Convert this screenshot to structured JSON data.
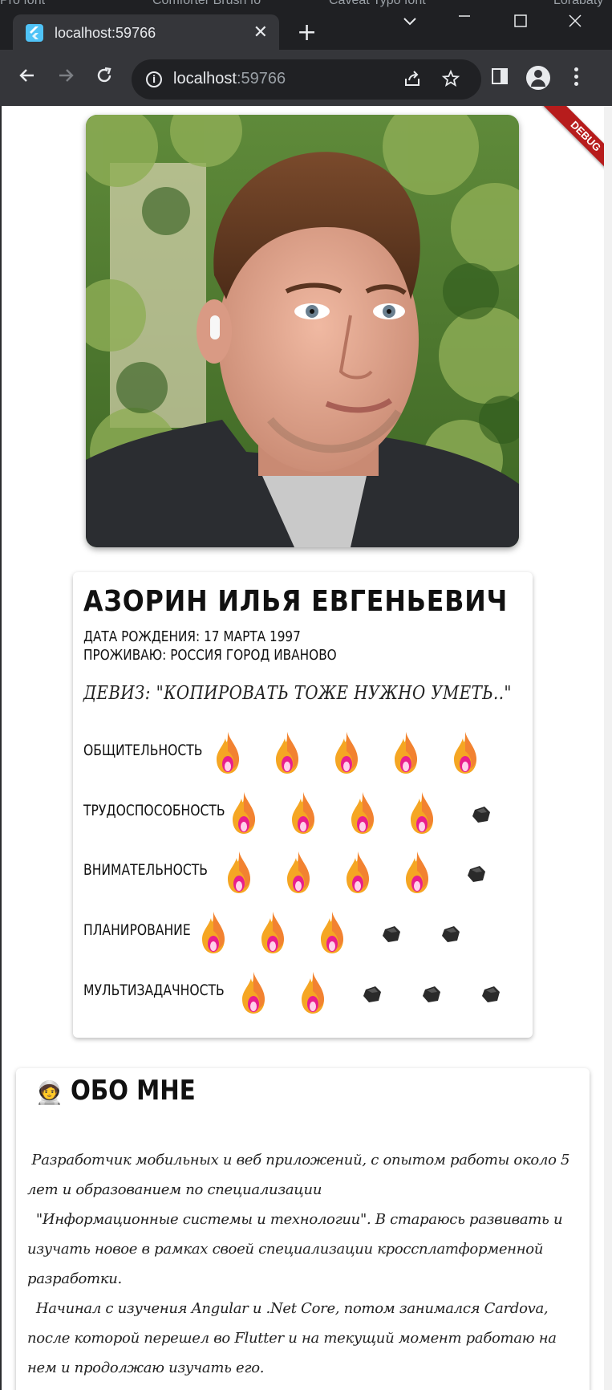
{
  "browser": {
    "tab_title": "localhost:59766",
    "tab_close": "✕",
    "new_tab": "+",
    "background_tabs": [
      "Pro font",
      "Comforter Brush fo",
      "Caveat Typo font",
      "Lorabaty"
    ],
    "url_host": "localhost",
    "url_port": ":59766",
    "icons": [
      "back-icon",
      "forward-icon",
      "reload-icon",
      "info-icon",
      "share-icon",
      "bookmark-star-icon",
      "side-panel-icon",
      "profile-icon",
      "menu-icon",
      "minimize-icon",
      "maximize-icon",
      "close-icon",
      "tab-search-icon"
    ]
  },
  "debug_banner": "DEBUG",
  "profile": {
    "name": "АЗОРИН ИЛЬЯ ЕВГЕНЬЕВИЧ",
    "birth": "ДАТА РОЖДЕНИЯ: 17 МАРТА 1997",
    "residence": "ПРОЖИВАЮ: РОССИЯ ГОРОД ИВАНОВО",
    "motto": "ДЕВИЗ: \"КОПИРОВАТЬ ТОЖЕ НУЖНО УМЕТЬ..\"",
    "skills": [
      {
        "label": "ОБЩИТЕЛЬНОСТЬ",
        "rating": 5,
        "max": 5
      },
      {
        "label": "ТРУДОСПОСОБНОСТЬ",
        "rating": 4,
        "max": 5
      },
      {
        "label": "ВНИМАТЕЛЬНОСТЬ",
        "rating": 4,
        "max": 5
      },
      {
        "label": "ПЛАНИРОВАНИЕ",
        "rating": 3,
        "max": 5
      },
      {
        "label": "МУЛЬТИЗАДАЧНОСТЬ",
        "rating": 2,
        "max": 5
      }
    ],
    "rating_icons": {
      "filled": "fire-icon",
      "empty": "coal-icon"
    }
  },
  "about": {
    "icon": "🧑‍🚀",
    "title": "ОБО МНЕ",
    "text": " Разработчик мобильных и веб приложений, с опытом работы около 5 лет и образованием по специализации\n  \"Информационные системы и технологии\". В стараюсь развивать и изучать новое в рамках своей специализации кроссплатформенной разработки.\n  Начинал с изучения Angular и .Net Core, потом занимался Cardova, после которой перешел во Flutter и на текущий момент работаю на нем и продолжаю изучать его."
  },
  "colors": {
    "flame_outer": "#f5a623",
    "flame_inner": "#e91e8c",
    "coal": "#2a2a2a",
    "debug": "#b71c1c"
  }
}
